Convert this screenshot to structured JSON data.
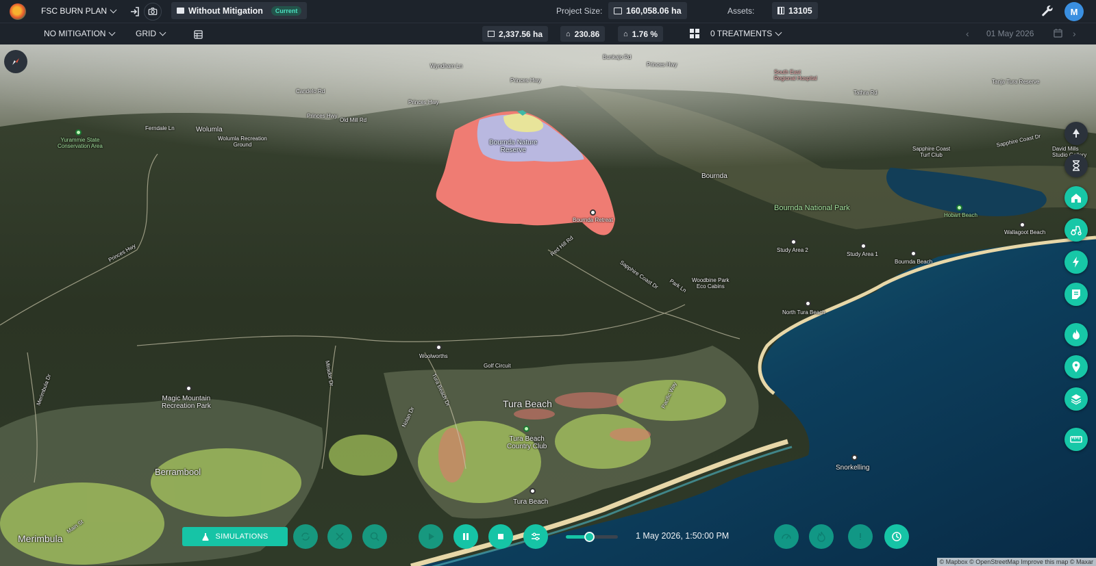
{
  "header": {
    "app_menu": "FSC BURN PLAN",
    "scenario_name": "Without Mitigation",
    "scenario_badge": "Current",
    "project_size_label": "Project Size:",
    "project_size_value": "160,058.06 ha",
    "assets_label": "Assets:",
    "assets_value": "13105",
    "avatar_initial": "M"
  },
  "subbar": {
    "mitigation_dropdown": "NO MITIGATION",
    "grid_dropdown": "GRID",
    "area_stat": "2,337.56 ha",
    "houses_stat": "230.86",
    "percent_stat": "1.76 %",
    "treatments_dropdown": "0 TREATMENTS",
    "date": "01 May 2026"
  },
  "map": {
    "labels": {
      "bournda_nature_reserve": "Bournda Nature\nReserve",
      "bournda_retreat": "Bournda Retreat",
      "bournda": "Bournda",
      "bournda_national_park": "Bournda National Park",
      "hobart_beach": "Hobart Beach",
      "wallagoot_beach": "Wallagoot Beach",
      "study_area_2": "Study Area 2",
      "study_area_1": "Study Area 1",
      "bournda_beach": "Bournda Beach",
      "woodbine_park": "Woodbine Park\nEco Cabins",
      "north_tura_beach": "North Tura Beach",
      "woolworths": "Woolworths",
      "golf_circuit": "Golf Circuit",
      "tura_beach": "Tura Beach",
      "tura_beach_country_club": "Tura Beach\nCountry Club",
      "tura_beach_south": "Tura Beach",
      "snorkelling": "Snorkelling",
      "magic_mountain": "Magic Mountain\nRecreation Park",
      "berrambool": "Berrambool",
      "merimbula": "Merimbula",
      "main_st": "Main St",
      "wolumla": "Wolumla",
      "wolumla_recreation": "Wolumla Recreation\nGround",
      "yurammie": "Yurammie State\nConservation Area",
      "ferndale_ln": "Ferndale Ln",
      "princes_hwy_1": "Princes Hwy",
      "princes_hwy_2": "Princes Hwy",
      "princes_hwy_3": "Princes Hwy",
      "princes_hwy_4": "Princes Hwy",
      "princes_hwy_5": "Princes Hwy",
      "old_mill_rd": "Old Mill Rd",
      "red_hill_rd": "Red Hill Rd",
      "sapphire_coast_dr": "Sapphire Coast Dr",
      "park_ln": "Park Ln",
      "mirador_dr": "Mirador Dr",
      "nolan_dr": "Nolan Dr",
      "tura_beach_dr": "Tura Beach Dr",
      "pacific_way": "Pacific Way",
      "merimbula_dr": "Merimbula Dr",
      "sapphire_coast_turf": "Sapphire Coast\nTurf Club",
      "sapphire_coast_dr_2": "Sapphire Coast Dr",
      "david_mills": "David Mills\nStudio Gallery",
      "tathra_rd": "Tathra Rd",
      "wyndham_ln": "Wyndham Ln",
      "bunkajo_rd": "Bunkajo Rd",
      "candelo_rd": "Candelo Rd",
      "south_east_hospital": "South East\nRegional Hospital",
      "tanja_lagoon": "Tanja Tura Reserve"
    }
  },
  "bottom": {
    "simulations_label": "SIMULATIONS",
    "timestamp": "1 May 2026, 1:50:00 PM",
    "playback_progress": 0.45,
    "attribution": "© Mapbox © OpenStreetMap  Improve this map © Maxar"
  },
  "colors": {
    "accent": "#16c4a6",
    "fire_red": "#ef7c73",
    "fire_lavender": "#b9b8e0",
    "fire_yellow": "#e8e49a",
    "bar_bg": "#1d232b"
  }
}
